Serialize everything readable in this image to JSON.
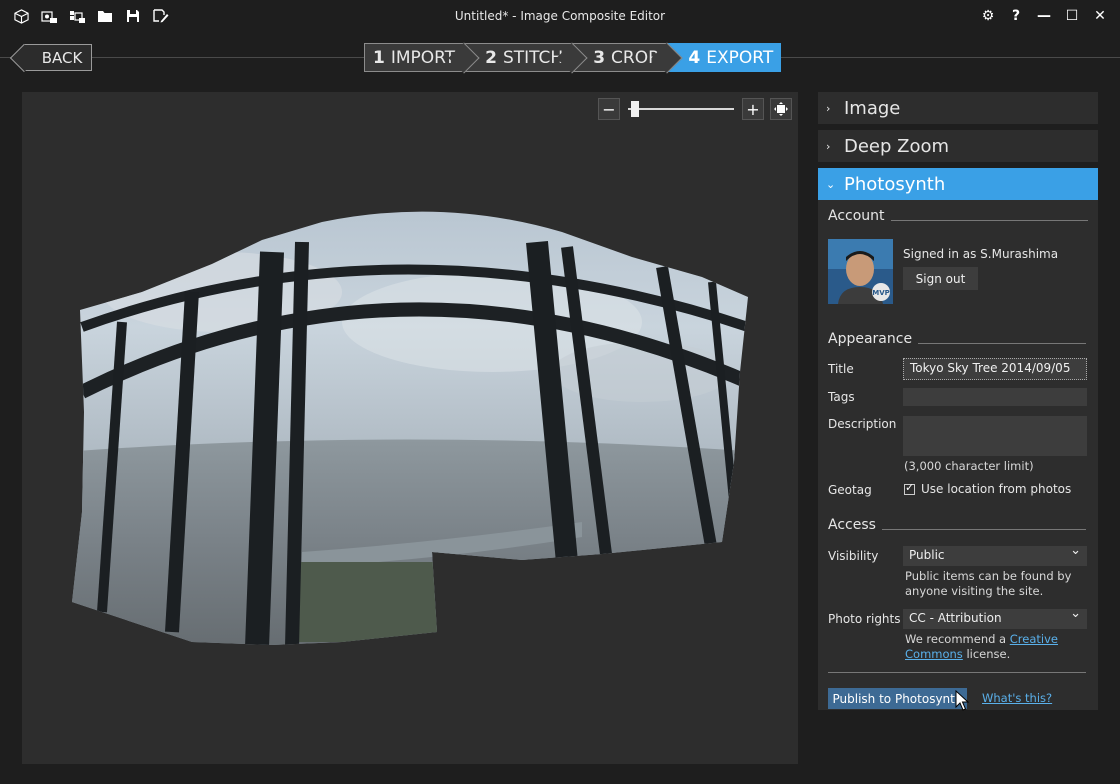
{
  "window": {
    "title": "Untitled* - Image Composite Editor",
    "toolbar_icons": [
      "new-project-icon",
      "new-panorama-icon",
      "new-video-panorama-icon",
      "open-icon",
      "save-icon",
      "export-settings-icon"
    ],
    "controls": [
      "⚙",
      "?",
      "—",
      "☐",
      "✕"
    ]
  },
  "nav": {
    "back_label": "BACK",
    "steps": [
      {
        "num": "1",
        "label": "IMPORT"
      },
      {
        "num": "2",
        "label": "STITCH"
      },
      {
        "num": "3",
        "label": "CROP"
      },
      {
        "num": "4",
        "label": "EXPORT"
      }
    ]
  },
  "zoom": {
    "minus": "−",
    "plus": "+",
    "level": 0.05
  },
  "sections": {
    "image": "Image",
    "deep_zoom": "Deep Zoom",
    "photosynth": "Photosynth"
  },
  "account": {
    "heading": "Account",
    "signed_in": "Signed in as S.Murashima",
    "sign_out": "Sign out",
    "badge": "MVP"
  },
  "appearance": {
    "heading": "Appearance",
    "title_label": "Title",
    "title_value": "Tokyo Sky Tree  2014/09/05",
    "tags_label": "Tags",
    "tags_value": "",
    "description_label": "Description",
    "description_value": "",
    "char_limit": "(3,000 character limit)",
    "geotag_label": "Geotag",
    "geotag_option": "Use location from photos"
  },
  "access": {
    "heading": "Access",
    "visibility_label": "Visibility",
    "visibility_value": "Public",
    "visibility_hint": "Public items can be found by anyone visiting the site.",
    "rights_label": "Photo rights",
    "rights_value": "CC - Attribution",
    "rights_hint_pre": "We recommend a ",
    "rights_hint_link": "Creative Commons",
    "rights_hint_post": " license."
  },
  "publish": {
    "button": "Publish to Photosynth",
    "whats_this": "What's this?"
  },
  "colors": {
    "accent": "#3aa0e6",
    "background": "#1e1e1e",
    "panel": "#2d2d2d"
  }
}
